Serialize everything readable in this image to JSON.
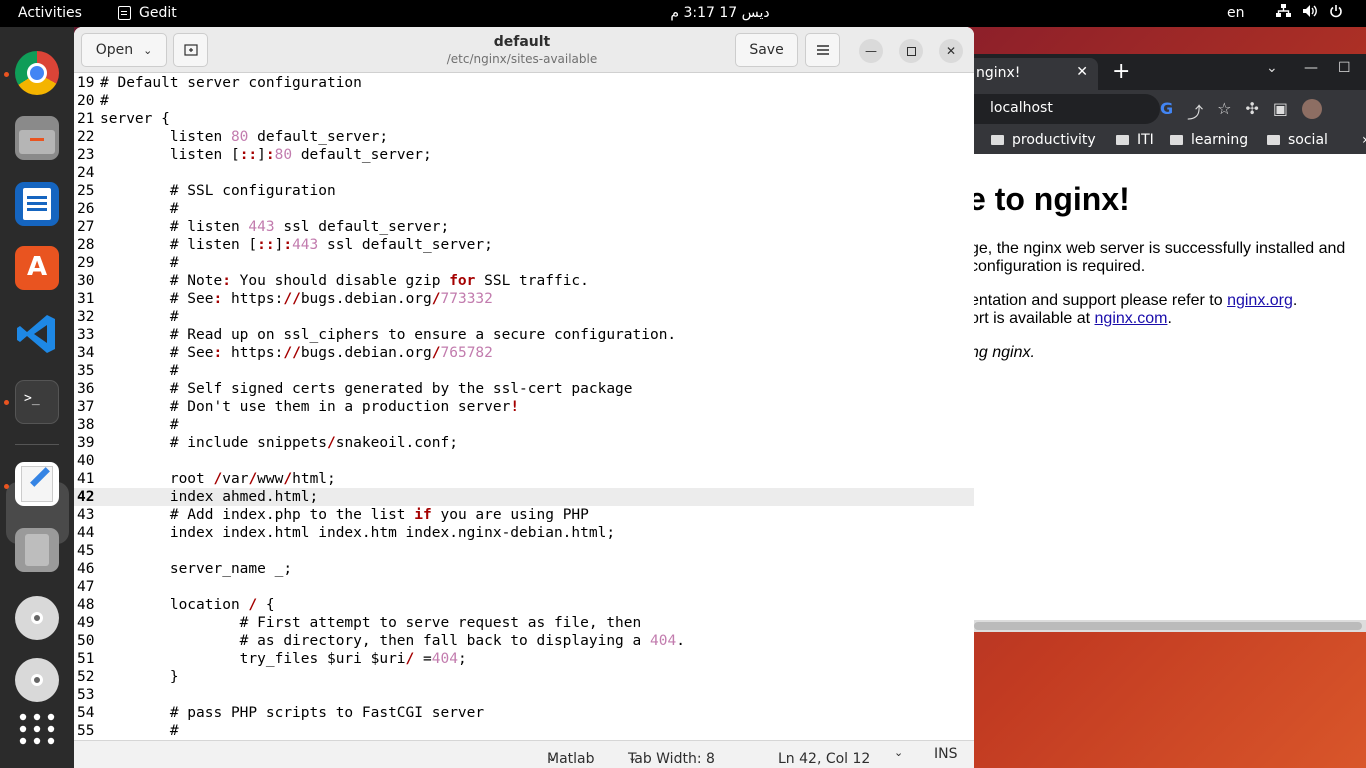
{
  "topbar": {
    "activities": "Activities",
    "app_name": "Gedit",
    "clock": "ديس 17  3:17 م",
    "lang": "en",
    "tray_icons": [
      "network-icon",
      "volume-icon",
      "power-icon"
    ]
  },
  "dock": {
    "items": [
      "chrome",
      "files",
      "libreoffice-writer",
      "app-center",
      "vscode",
      "terminal",
      "gedit",
      "disks",
      "dvd",
      "dvd",
      "show-apps"
    ]
  },
  "browser": {
    "tab_title": "nginx!",
    "url": "localhost",
    "bookmarks": [
      "productivity",
      "ITI",
      "learning",
      "social"
    ],
    "heading": "e to nginx!",
    "p1_line1": "ge, the nginx web server is successfully installed and",
    "p1_line2": "configuration is required.",
    "p2_line1_pre": "entation and support please refer to ",
    "p2_link1": "nginx.org",
    "p2_line1_post": ".",
    "p2_line2_pre": "ort is available at ",
    "p2_link2": "nginx.com",
    "p2_line2_post": ".",
    "p3": "ng nginx."
  },
  "gedit": {
    "open_label": "Open",
    "save_label": "Save",
    "title": "default",
    "subtitle": "/etc/nginx/sites-available",
    "status": {
      "language": "Matlab",
      "tab_width": "Tab Width: 8",
      "position": "Ln 42, Col 12",
      "mode": "INS"
    },
    "current_line": 42,
    "lines": [
      {
        "n": "19",
        "t": "# Default server configuration"
      },
      {
        "n": "20",
        "t": "#"
      },
      {
        "n": "21",
        "t": "server {"
      },
      {
        "n": "22",
        "t": "        listen 80 default_server;"
      },
      {
        "n": "23",
        "t": "        listen [::]:80 default_server;"
      },
      {
        "n": "24",
        "t": ""
      },
      {
        "n": "25",
        "t": "        # SSL configuration"
      },
      {
        "n": "26",
        "t": "        #"
      },
      {
        "n": "27",
        "t": "        # listen 443 ssl default_server;"
      },
      {
        "n": "28",
        "t": "        # listen [::]:443 ssl default_server;"
      },
      {
        "n": "29",
        "t": "        #"
      },
      {
        "n": "30",
        "t": "        # Note: You should disable gzip for SSL traffic."
      },
      {
        "n": "31",
        "t": "        # See: https://bugs.debian.org/773332"
      },
      {
        "n": "32",
        "t": "        #"
      },
      {
        "n": "33",
        "t": "        # Read up on ssl_ciphers to ensure a secure configuration."
      },
      {
        "n": "34",
        "t": "        # See: https://bugs.debian.org/765782"
      },
      {
        "n": "35",
        "t": "        #"
      },
      {
        "n": "36",
        "t": "        # Self signed certs generated by the ssl-cert package"
      },
      {
        "n": "37",
        "t": "        # Don't use them in a production server!"
      },
      {
        "n": "38",
        "t": "        #"
      },
      {
        "n": "39",
        "t": "        # include snippets/snakeoil.conf;"
      },
      {
        "n": "40",
        "t": ""
      },
      {
        "n": "41",
        "t": "        root /var/www/html;"
      },
      {
        "n": "42",
        "t": "        index ahmed.html;"
      },
      {
        "n": "43",
        "t": "        # Add index.php to the list if you are using PHP"
      },
      {
        "n": "44",
        "t": "        index index.html index.htm index.nginx-debian.html;"
      },
      {
        "n": "45",
        "t": ""
      },
      {
        "n": "46",
        "t": "        server_name _;"
      },
      {
        "n": "47",
        "t": ""
      },
      {
        "n": "48",
        "t": "        location / {"
      },
      {
        "n": "49",
        "t": "                # First attempt to serve request as file, then"
      },
      {
        "n": "50",
        "t": "                # as directory, then fall back to displaying a 404."
      },
      {
        "n": "51",
        "t": "                try_files $uri $uri/ =404;"
      },
      {
        "n": "52",
        "t": "        }"
      },
      {
        "n": "53",
        "t": ""
      },
      {
        "n": "54",
        "t": "        # pass PHP scripts to FastCGI server"
      },
      {
        "n": "55",
        "t": "        #"
      }
    ]
  }
}
